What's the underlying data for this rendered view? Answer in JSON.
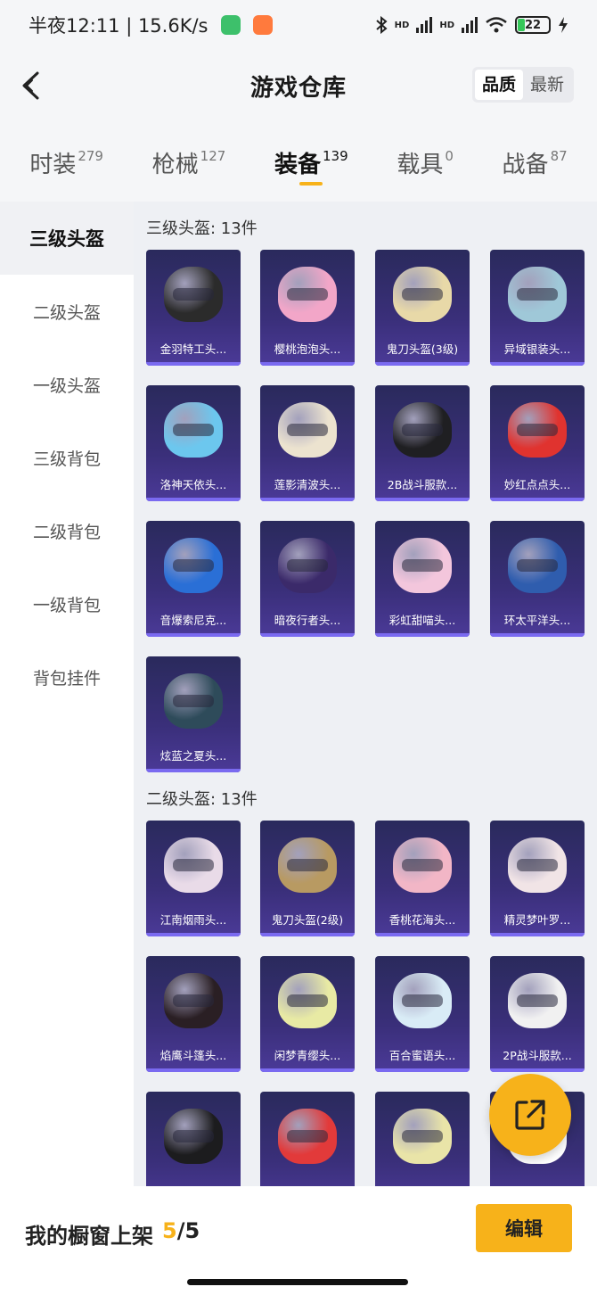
{
  "status_bar": {
    "time_speed": "半夜12:11 | 15.6K/s",
    "hd1": "HD",
    "hd2": "HD",
    "battery": "22",
    "icons": [
      "wechat-icon",
      "taobao-icon",
      "bluetooth-icon",
      "signal-icon",
      "signal-icon",
      "wifi-icon",
      "battery-icon",
      "charging-icon"
    ]
  },
  "header": {
    "title": "游戏仓库",
    "sort_options": [
      "品质",
      "最新"
    ],
    "sort_active": "品质"
  },
  "tabs": [
    {
      "label": "时装",
      "count": "279"
    },
    {
      "label": "枪械",
      "count": "127"
    },
    {
      "label": "装备",
      "count": "139",
      "active": true
    },
    {
      "label": "载具",
      "count": "0"
    },
    {
      "label": "战备",
      "count": "87"
    }
  ],
  "sidebar": {
    "items": [
      "三级头盔",
      "二级头盔",
      "一级头盔",
      "三级背包",
      "二级背包",
      "一级背包",
      "背包挂件"
    ],
    "active": "三级头盔"
  },
  "sections": [
    {
      "title": "三级头盔: 13件",
      "items": [
        {
          "name": "金羽特工头...",
          "color": "#2b2b2b"
        },
        {
          "name": "樱桃泡泡头...",
          "color": "#f2a6c8"
        },
        {
          "name": "鬼刀头盔(3级)",
          "color": "#e8d9a8"
        },
        {
          "name": "异域银装头...",
          "color": "#9fc8d8"
        },
        {
          "name": "洛神天依头...",
          "color": "#6cc7ee"
        },
        {
          "name": "莲影清波头...",
          "color": "#ece3cf"
        },
        {
          "name": "2B战斗服款...",
          "color": "#1f1f22"
        },
        {
          "name": "妙红点点头...",
          "color": "#e0332f"
        },
        {
          "name": "音爆索尼克...",
          "color": "#2a6fd6"
        },
        {
          "name": "暗夜行者头...",
          "color": "#3b2a6a"
        },
        {
          "name": "彩虹甜喵头...",
          "color": "#f3c6dc"
        },
        {
          "name": "环太平洋头...",
          "color": "#2f5dae"
        },
        {
          "name": "炫蓝之夏头...",
          "color": "#2e4b5a"
        }
      ]
    },
    {
      "title": "二级头盔: 13件",
      "items": [
        {
          "name": "江南烟雨头...",
          "color": "#e9dbe8"
        },
        {
          "name": "鬼刀头盔(2级)",
          "color": "#b89a62"
        },
        {
          "name": "香桃花海头...",
          "color": "#f2b6c6"
        },
        {
          "name": "精灵梦叶罗...",
          "color": "#f1e4e6"
        },
        {
          "name": "焰鹰斗篷头...",
          "color": "#2a1f24"
        },
        {
          "name": "闲梦青缨头...",
          "color": "#e8eaa4"
        },
        {
          "name": "百合蜜语头...",
          "color": "#d9ecf6"
        },
        {
          "name": "2P战斗服款...",
          "color": "#f1f1f1"
        },
        {
          "name": "",
          "color": "#1c1c1e"
        },
        {
          "name": "",
          "color": "#e23a3a"
        },
        {
          "name": "",
          "color": "#e9e4a8"
        },
        {
          "name": "",
          "color": "#ffffff"
        }
      ]
    }
  ],
  "bottom_bar": {
    "label": "我的橱窗上架",
    "current": "5",
    "total": "/5",
    "edit": "编辑"
  },
  "fab_icon": "share-icon",
  "accent": "#f7b21a"
}
